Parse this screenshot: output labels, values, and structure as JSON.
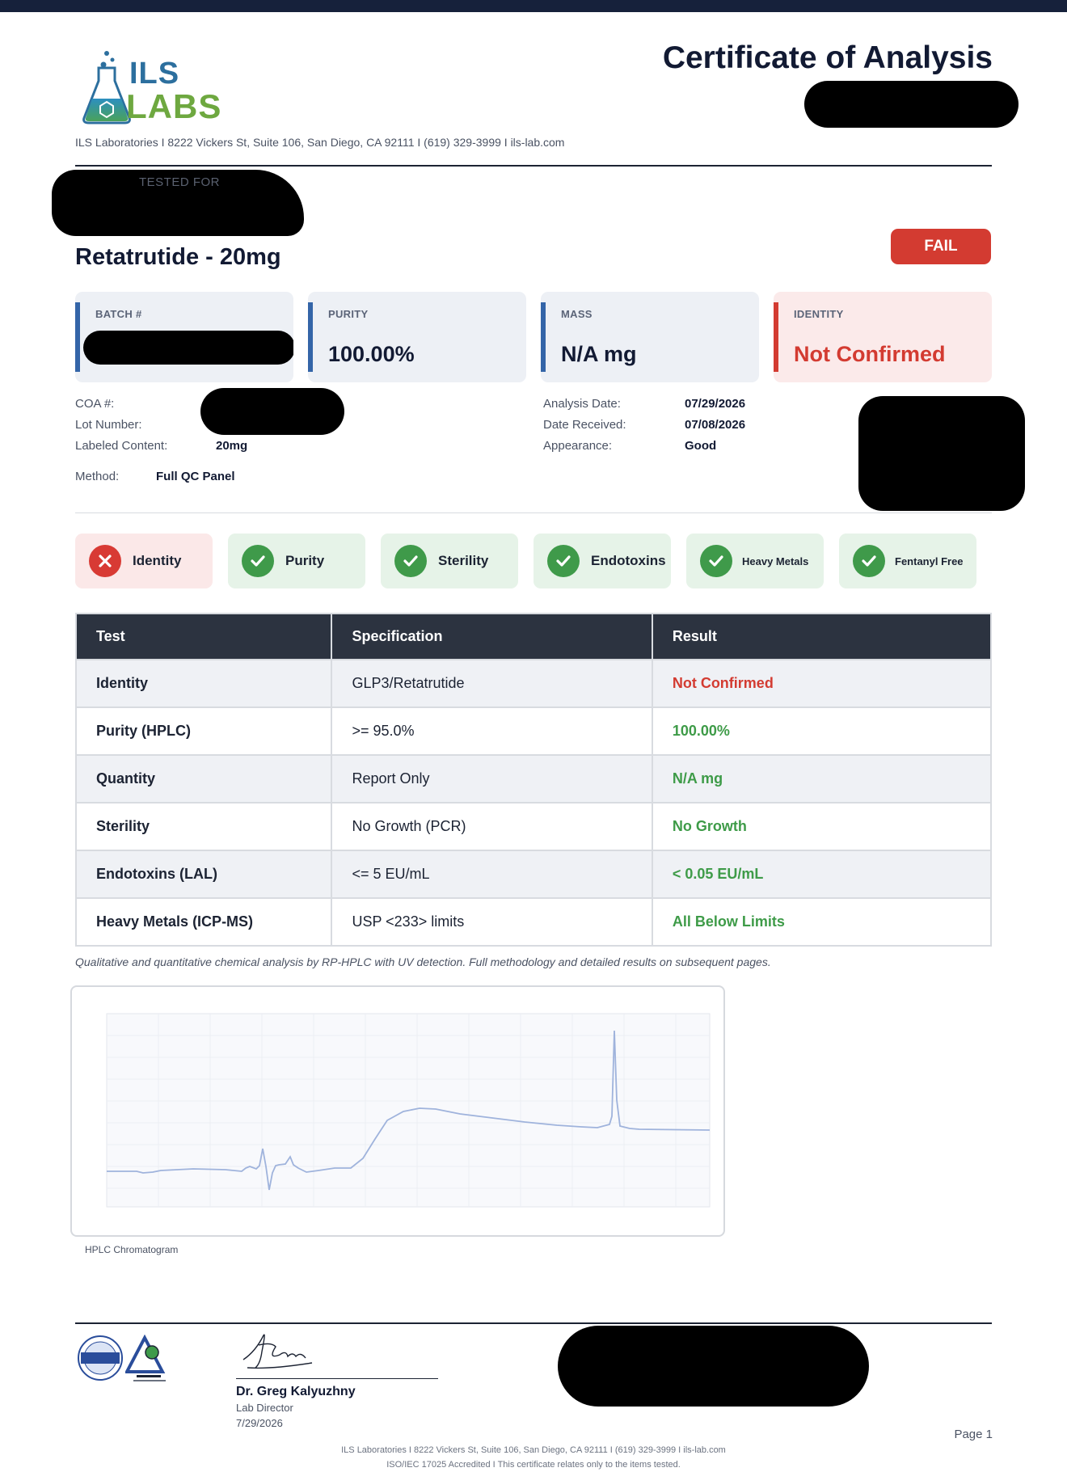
{
  "header": {
    "logo_top": "ILS",
    "logo_bottom": "LABS",
    "lab_address": "ILS Laboratories  I  8222 Vickers St, Suite 106, San Diego, CA 92111  I  (619) 329-3999  I  ils-lab.com",
    "doc_title": "Certificate of Analysis"
  },
  "client": {
    "tested_for_label": "TESTED FOR",
    "product_name": "Retatrutide - 20mg",
    "overall_status": "FAIL"
  },
  "cards": {
    "batch_label": "BATCH #",
    "purity_label": "PURITY",
    "purity_value": "100.00%",
    "mass_label": "MASS",
    "mass_value": "N/A mg",
    "identity_label": "IDENTITY",
    "identity_value": "Not Confirmed"
  },
  "meta": {
    "coa_label": "COA #:",
    "lot_label": "Lot Number:",
    "labeled_label": "Labeled Content:",
    "labeled_value": "20mg",
    "method_label": "Method:",
    "method_value": "Full QC Panel",
    "analysis_label": "Analysis Date:",
    "analysis_value": "07/29/2026",
    "received_label": "Date Received:",
    "received_value": "07/08/2026",
    "appearance_label": "Appearance:",
    "appearance_value": "Good"
  },
  "status_pills": [
    {
      "label": "Identity",
      "status": "fail"
    },
    {
      "label": "Purity",
      "status": "pass"
    },
    {
      "label": "Sterility",
      "status": "pass"
    },
    {
      "label": "Endotoxins",
      "status": "pass"
    },
    {
      "label": "Heavy Metals",
      "status": "pass"
    },
    {
      "label": "Fentanyl Free",
      "status": "pass"
    }
  ],
  "table": {
    "headers": [
      "Test",
      "Specification",
      "Result"
    ],
    "rows": [
      {
        "test": "Identity",
        "spec": "GLP3/Retatrutide",
        "result": "Not Confirmed",
        "ok": false
      },
      {
        "test": "Purity (HPLC)",
        "spec": ">= 95.0%",
        "result": "100.00%",
        "ok": true
      },
      {
        "test": "Quantity",
        "spec": "Report Only",
        "result": "N/A mg",
        "ok": true
      },
      {
        "test": "Sterility",
        "spec": "No Growth (PCR)",
        "result": "No Growth",
        "ok": true
      },
      {
        "test": "Endotoxins (LAL)",
        "spec": "<= 5 EU/mL",
        "result": "< 0.05 EU/mL",
        "ok": true
      },
      {
        "test": "Heavy Metals (ICP-MS)",
        "spec": "USP <233> limits",
        "result": "All Below Limits",
        "ok": true
      }
    ]
  },
  "note": "Qualitative and quantitative chemical analysis by RP-HPLC with UV detection. Full methodology and detailed results on subsequent pages.",
  "chromatogram": {
    "caption": "HPLC Chromatogram"
  },
  "footer": {
    "signer_name": "Dr. Greg Kalyuzhny",
    "signer_title": "Lab Director",
    "sign_date": "7/29/2026",
    "page": "Page 1",
    "line1": "ILS Laboratories  I  8222 Vickers St, Suite 106, San Diego, CA 92111  I  (619) 329-3999  I  ils-lab.com",
    "line2": "ISO/IEC 17025 Accredited  I  This certificate relates only to the items tested."
  },
  "colors": {
    "navy": "#16213b",
    "fail_red": "#d33b31",
    "pass_green": "#3f9a4a",
    "card_blue": "#3465a8"
  }
}
